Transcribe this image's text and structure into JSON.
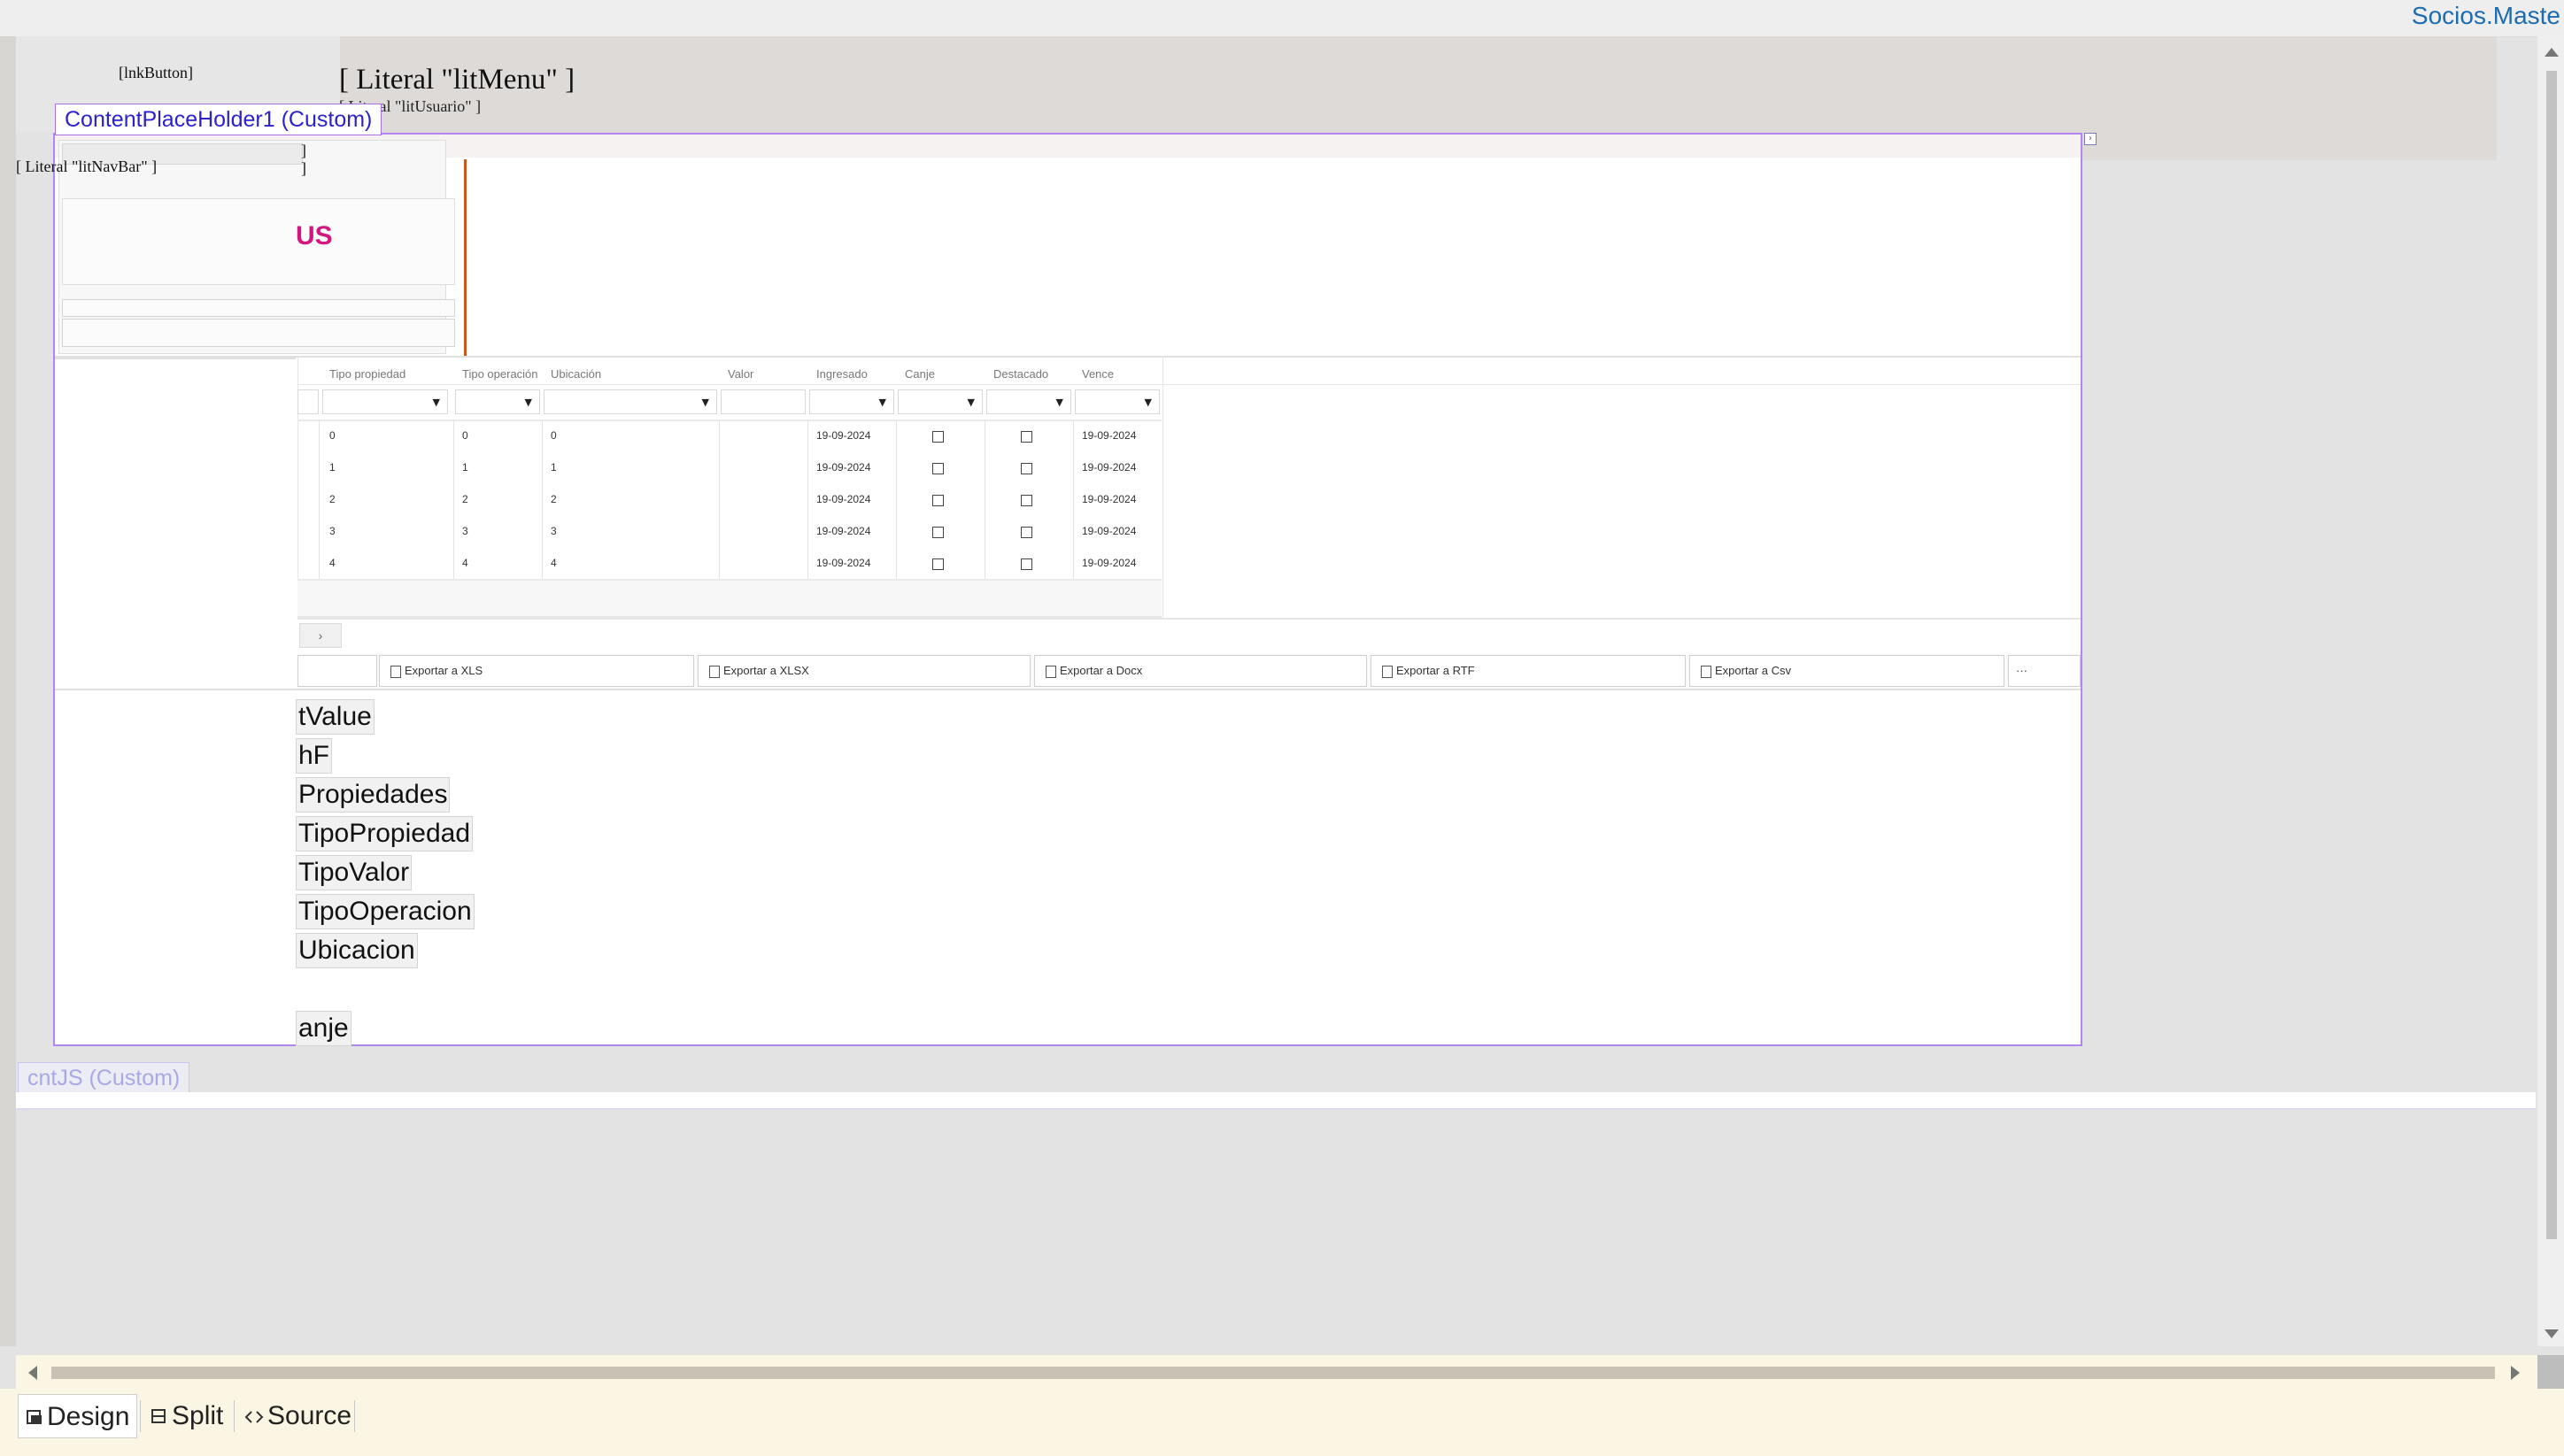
{
  "window": {
    "file_tab": "Socios.Maste"
  },
  "master": {
    "lnk_button": "[lnkButton]",
    "lit_menu": "[ Literal \"litMenu\" ]",
    "lit_usuario": "[ Literal \"litUsuario\" ]",
    "lit_navbar": "[ Literal \"litNavBar\" ]"
  },
  "content_placeholder": {
    "label": "ContentPlaceHolder1 (Custom)",
    "brand_partial": "US",
    "bracket_1": "]",
    "bracket_2": "]"
  },
  "grid": {
    "columns": [
      "Tipo propiedad",
      "Tipo operación",
      "Ubicación",
      "Valor",
      "Ingresado",
      "Canje",
      "Destacado",
      "Vence"
    ],
    "rows": [
      {
        "tipo_propiedad": "0",
        "tipo_operacion": "0",
        "ubicacion": "0",
        "valor": "",
        "ingresado": "19-09-2024",
        "canje": false,
        "destacado": false,
        "vence": "19-09-2024"
      },
      {
        "tipo_propiedad": "1",
        "tipo_operacion": "1",
        "ubicacion": "1",
        "valor": "",
        "ingresado": "19-09-2024",
        "canje": false,
        "destacado": false,
        "vence": "19-09-2024"
      },
      {
        "tipo_propiedad": "2",
        "tipo_operacion": "2",
        "ubicacion": "2",
        "valor": "",
        "ingresado": "19-09-2024",
        "canje": false,
        "destacado": false,
        "vence": "19-09-2024"
      },
      {
        "tipo_propiedad": "3",
        "tipo_operacion": "3",
        "ubicacion": "3",
        "valor": "",
        "ingresado": "19-09-2024",
        "canje": false,
        "destacado": false,
        "vence": "19-09-2024"
      },
      {
        "tipo_propiedad": "4",
        "tipo_operacion": "4",
        "ubicacion": "4",
        "valor": "",
        "ingresado": "19-09-2024",
        "canje": false,
        "destacado": false,
        "vence": "19-09-2024"
      }
    ],
    "pager_next": "›"
  },
  "export": {
    "buttons": [
      "Exportar a XLS",
      "Exportar a XLSX",
      "Exportar a Docx",
      "Exportar a RTF",
      "Exportar a Csv"
    ],
    "more": "···"
  },
  "hidden_fields": [
    "tValue",
    "hF",
    "Propiedades",
    "TipoPropiedad",
    "TipoValor",
    "TipoOperacion",
    "Ubicacion",
    "anje"
  ],
  "cnt_js": {
    "label": "cntJS (Custom)"
  },
  "bottom_tabs": {
    "design": "Design",
    "split": "Split",
    "source": "Source"
  },
  "icons": [
    "design-icon",
    "split-icon",
    "source-icon",
    "scroll-up-arrow-icon",
    "scroll-down-arrow-icon",
    "scroll-left-arrow-icon",
    "scroll-right-arrow-icon",
    "dropdown-caret-icon",
    "export-doc-icon",
    "smart-tag-icon"
  ]
}
